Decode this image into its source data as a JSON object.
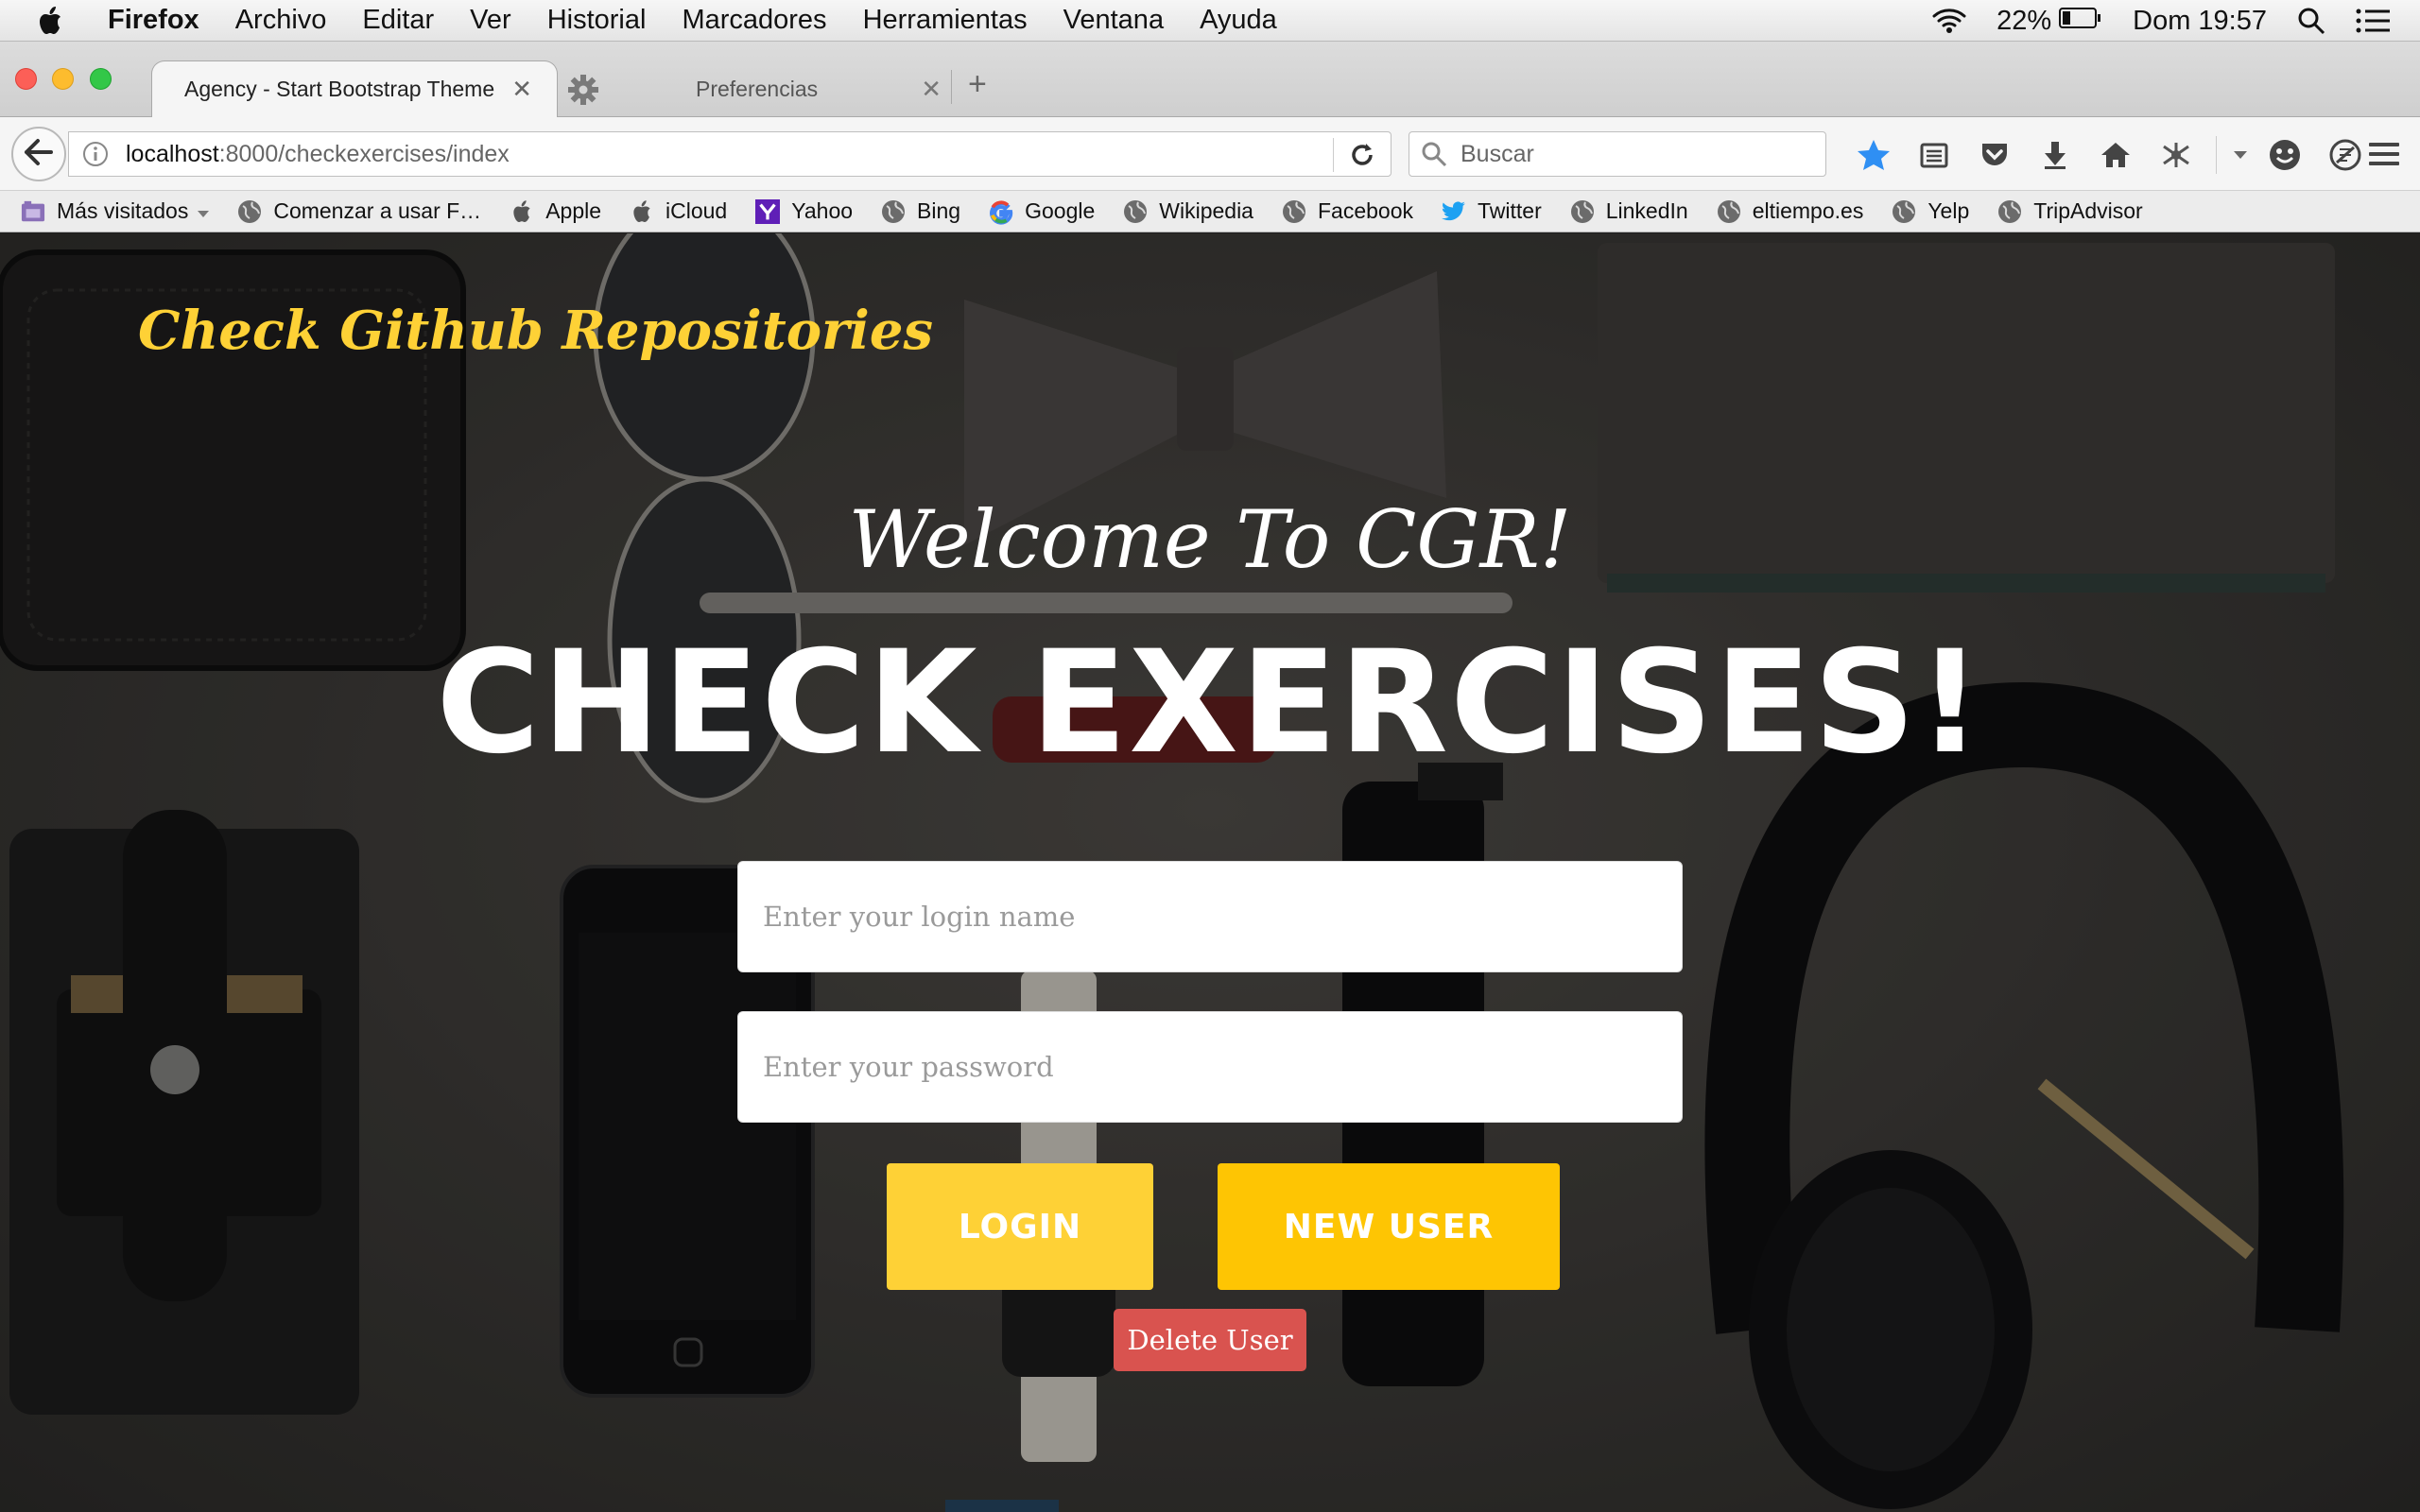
{
  "menubar": {
    "app_name": "Firefox",
    "items": [
      "Archivo",
      "Editar",
      "Ver",
      "Historial",
      "Marcadores",
      "Herramientas",
      "Ventana",
      "Ayuda"
    ],
    "battery": "22%",
    "clock": "Dom 19:57",
    "icons": [
      "apple-icon",
      "wifi-icon",
      "battery-icon",
      "spotlight-icon",
      "notification-center-icon"
    ]
  },
  "tabs": [
    {
      "title": "Agency - Start Bootstrap Theme",
      "active": true
    },
    {
      "title": "Preferencias",
      "active": false,
      "icon": "gear-icon"
    }
  ],
  "navbar": {
    "url_host": "localhost",
    "url_path": ":8000/checkexercises/index",
    "search_placeholder": "Buscar",
    "icons": [
      "back-icon",
      "info-icon",
      "reload-icon",
      "search-icon",
      "bookmark-star-icon",
      "reading-list-icon",
      "pocket-icon",
      "download-icon",
      "home-icon",
      "extension-icon",
      "dropdown-icon",
      "emoji-icon",
      "sync-icon",
      "menu-icon"
    ]
  },
  "bookmarks": [
    {
      "label": "Más visitados",
      "icon": "most-visited-icon"
    },
    {
      "label": "Comenzar a usar F…",
      "icon": "globe-icon"
    },
    {
      "label": "Apple",
      "icon": "apple-icon"
    },
    {
      "label": "iCloud",
      "icon": "apple-icon"
    },
    {
      "label": "Yahoo",
      "icon": "yahoo-icon"
    },
    {
      "label": "Bing",
      "icon": "globe-icon"
    },
    {
      "label": "Google",
      "icon": "google-icon"
    },
    {
      "label": "Wikipedia",
      "icon": "globe-icon"
    },
    {
      "label": "Facebook",
      "icon": "globe-icon"
    },
    {
      "label": "Twitter",
      "icon": "twitter-icon"
    },
    {
      "label": "LinkedIn",
      "icon": "globe-icon"
    },
    {
      "label": "eltiempo.es",
      "icon": "globe-icon"
    },
    {
      "label": "Yelp",
      "icon": "globe-icon"
    },
    {
      "label": "TripAdvisor",
      "icon": "globe-icon"
    }
  ],
  "page": {
    "brand": "Check Github Repositories",
    "welcome": "Welcome To CGR!",
    "headline": "CHECK EXERCISES!",
    "login_placeholder": "Enter your login name",
    "password_placeholder": "Enter your password",
    "login_button": "LOGIN",
    "new_user_button": "NEW USER",
    "delete_button": "Delete User"
  },
  "colors": {
    "brand_yellow": "#fed136",
    "new_user_yellow": "#fec503",
    "delete_red": "#d9534f"
  }
}
